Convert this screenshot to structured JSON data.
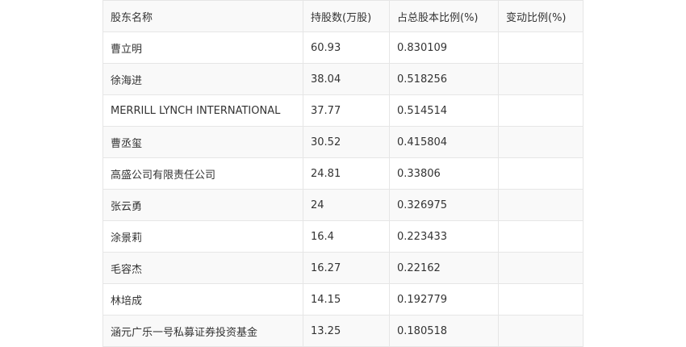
{
  "table": {
    "headers": [
      "股东名称",
      "持股数(万股)",
      "占总股本比例(%)",
      "变动比例(%)"
    ],
    "rows": [
      [
        "曹立明",
        "60.93",
        "0.830109",
        ""
      ],
      [
        "徐海进",
        "38.04",
        "0.518256",
        ""
      ],
      [
        "MERRILL LYNCH INTERNATIONAL",
        "37.77",
        "0.514514",
        ""
      ],
      [
        "曹丞玺",
        "30.52",
        "0.415804",
        ""
      ],
      [
        "高盛公司有限责任公司",
        "24.81",
        "0.33806",
        ""
      ],
      [
        "张云勇",
        "24",
        "0.326975",
        ""
      ],
      [
        "涂景莉",
        "16.4",
        "0.223433",
        ""
      ],
      [
        "毛容杰",
        "16.27",
        "0.22162",
        ""
      ],
      [
        "林培成",
        "14.15",
        "0.192779",
        ""
      ],
      [
        "涵元广乐一号私募证券投资基金",
        "13.25",
        "0.180518",
        ""
      ]
    ]
  }
}
